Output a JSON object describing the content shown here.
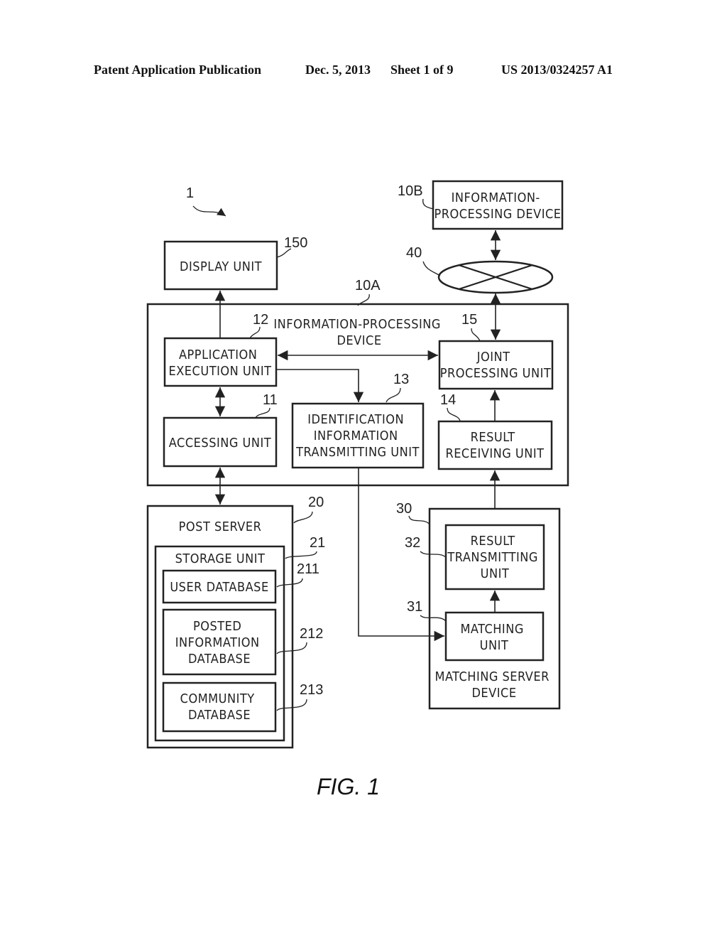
{
  "header": {
    "publication": "Patent Application Publication",
    "date": "Dec. 5, 2013",
    "sheet": "Sheet 1 of 9",
    "number": "US 2013/0324257 A1"
  },
  "figure_label": "FIG. 1",
  "refs": {
    "system": "1",
    "display": "150",
    "device_b": "10B",
    "network": "40",
    "device_a": "10A",
    "app_exec": "12",
    "joint": "15",
    "ident": "13",
    "accessing": "11",
    "result_recv": "14",
    "post_server": "20",
    "storage": "21",
    "user_db": "211",
    "posted_db": "212",
    "community_db": "213",
    "matching_server": "30",
    "result_trans": "32",
    "matching_unit": "31"
  },
  "blocks": {
    "display": [
      "DISPLAY UNIT"
    ],
    "device_b": [
      "INFORMATION-",
      "PROCESSING DEVICE"
    ],
    "device_a": [
      "INFORMATION-PROCESSING",
      "DEVICE"
    ],
    "app_exec": [
      "APPLICATION",
      "EXECUTION UNIT"
    ],
    "joint": [
      "JOINT",
      "PROCESSING UNIT"
    ],
    "ident": [
      "IDENTIFICATION",
      "INFORMATION",
      "TRANSMITTING UNIT"
    ],
    "accessing": [
      "ACCESSING UNIT"
    ],
    "result_recv": [
      "RESULT",
      "RECEIVING UNIT"
    ],
    "post_server": [
      "POST SERVER"
    ],
    "storage": [
      "STORAGE UNIT"
    ],
    "user_db": [
      "USER DATABASE"
    ],
    "posted_db": [
      "POSTED",
      "INFORMATION",
      "DATABASE"
    ],
    "community_db": [
      "COMMUNITY",
      "DATABASE"
    ],
    "result_trans": [
      "RESULT",
      "TRANSMITTING",
      "UNIT"
    ],
    "matching_unit": [
      "MATCHING",
      "UNIT"
    ],
    "matching_server": [
      "MATCHING SERVER",
      "DEVICE"
    ]
  }
}
